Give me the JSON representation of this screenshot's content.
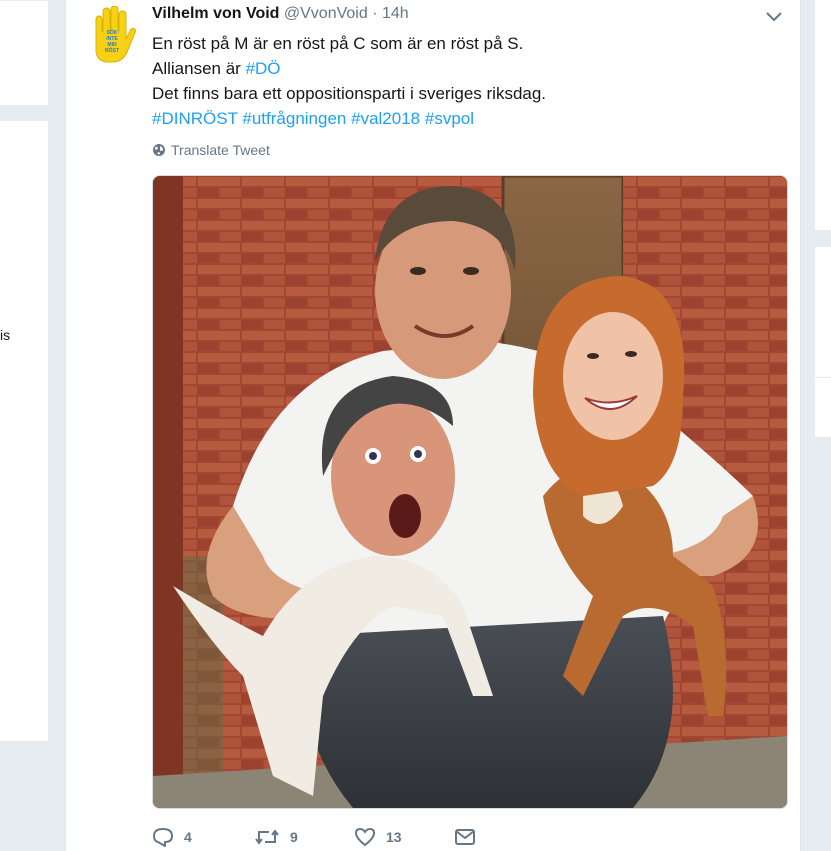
{
  "left_fragment": "is",
  "tweet": {
    "author_name": "Vilhelm von Void",
    "handle": "@VvonVoid",
    "separator": "·",
    "time": "14h",
    "lines": [
      "En röst på M är en röst på C som är en röst på S.",
      "Alliansen är ",
      "Det finns bara ett oppositionsparti i sveriges riksdag."
    ],
    "hashtag_do": "#DÖ",
    "hashtags": [
      "#DINRÖST",
      "#utfrågningen",
      "#val2018",
      "#svpol"
    ],
    "translate_label": "Translate Tweet",
    "actions": {
      "replies": "4",
      "retweets": "9",
      "likes": "13"
    },
    "avatar_text": [
      "SÖK",
      "INTE",
      "MIN",
      "RÖST"
    ],
    "colors": {
      "link": "#1da1f2",
      "muted": "#657786",
      "avatar_yellow": "#f7d118"
    }
  }
}
